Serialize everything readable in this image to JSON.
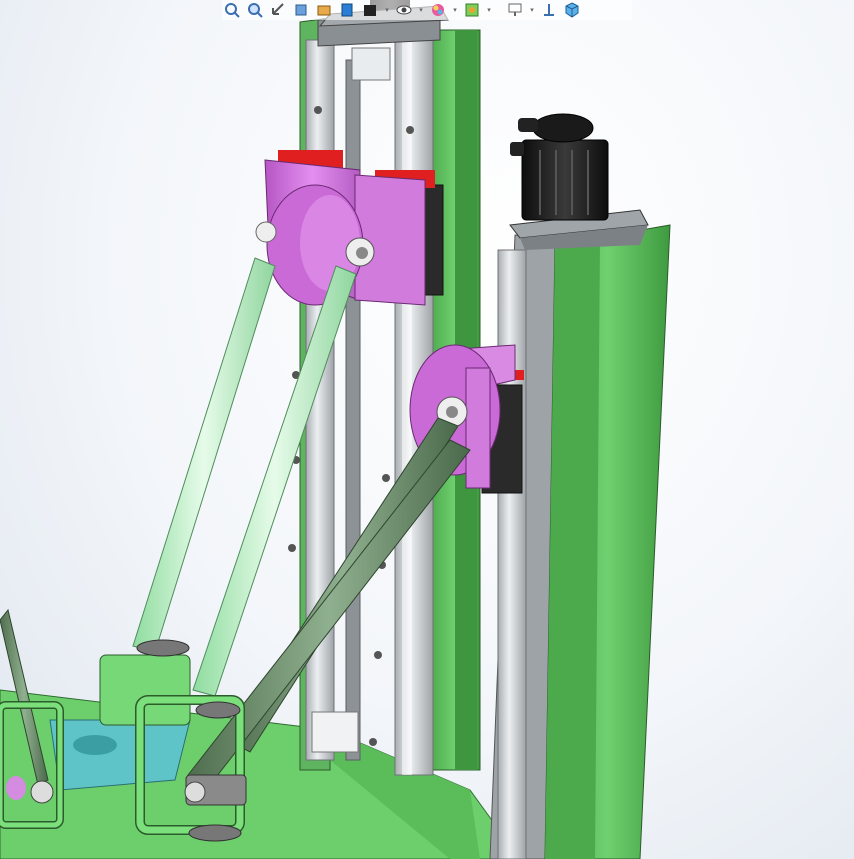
{
  "toolbar": {
    "icons": [
      "zoom-to-fit-icon",
      "zoom-to-area-icon",
      "previous-view-icon",
      "section-view-icon",
      "dynamic-annotation-icon",
      "view-orientation-icon",
      "display-style-icon",
      "hide-show-items-icon",
      "edit-appearance-icon",
      "apply-scene-icon",
      "view-settings-icon",
      "rotate-view-icon",
      "3d-view-cube-icon"
    ]
  },
  "colors": {
    "frame_green": "#5cb85c",
    "base_green": "#6fd36f",
    "carriage_purple": "#cc6fd6",
    "rod_light": "#b8efc4",
    "rod_dark": "#6d8f6d",
    "rail_grey": "#cfd3d6",
    "motor_black": "#1c1c1c",
    "effector_cyan": "#5fc4c8",
    "accent_red": "#e02020"
  }
}
